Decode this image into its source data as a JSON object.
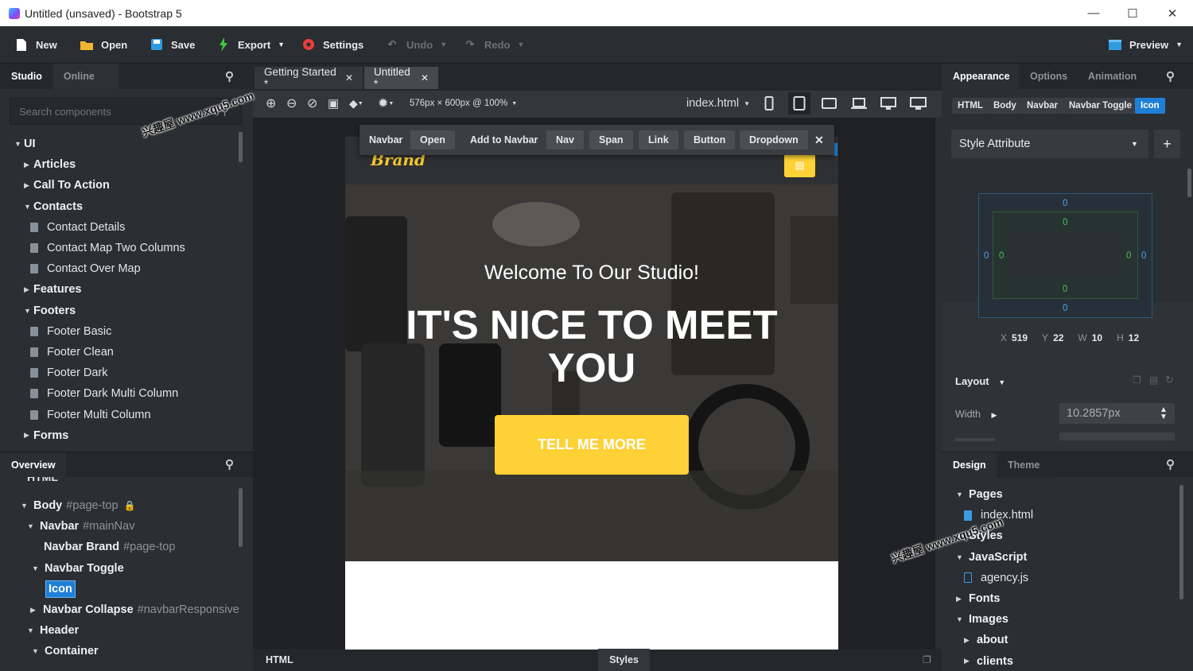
{
  "window": {
    "title": "Untitled (unsaved) - Bootstrap 5",
    "minimize": "—",
    "maximize": "☐",
    "close": "✕"
  },
  "toolbar": {
    "new": "New",
    "open": "Open",
    "save": "Save",
    "export": "Export",
    "settings": "Settings",
    "undo": "Undo",
    "redo": "Redo",
    "preview": "Preview"
  },
  "left_panel": {
    "tabs": [
      "Studio",
      "Online"
    ],
    "search_placeholder": "Search components",
    "tree": [
      {
        "label": "UI",
        "type": "group",
        "open": true
      },
      {
        "label": "Articles",
        "type": "folder",
        "open": false
      },
      {
        "label": "Call To Action",
        "type": "folder",
        "open": false
      },
      {
        "label": "Contacts",
        "type": "folder",
        "open": true
      },
      {
        "label": "Contact Details",
        "type": "item"
      },
      {
        "label": "Contact Map Two Columns",
        "type": "item"
      },
      {
        "label": "Contact Over Map",
        "type": "item"
      },
      {
        "label": "Features",
        "type": "folder",
        "open": false
      },
      {
        "label": "Footers",
        "type": "folder",
        "open": true
      },
      {
        "label": "Footer Basic",
        "type": "item"
      },
      {
        "label": "Footer Clean",
        "type": "item"
      },
      {
        "label": "Footer Dark",
        "type": "item"
      },
      {
        "label": "Footer Dark Multi Column",
        "type": "item"
      },
      {
        "label": "Footer Multi Column",
        "type": "item"
      },
      {
        "label": "Forms",
        "type": "folder",
        "open": false
      }
    ]
  },
  "overview": {
    "title": "Overview",
    "partial_top": "HTML",
    "rows": [
      {
        "label": "Body",
        "hint": "#page-top",
        "lock": "🔒"
      },
      {
        "label": "Navbar",
        "hint": "#mainNav"
      },
      {
        "label": "Navbar Brand",
        "hint": "#page-top"
      },
      {
        "label": "Navbar Toggle",
        "hint": ""
      },
      {
        "label": "Icon",
        "hint": ""
      },
      {
        "label": "Navbar Collapse",
        "hint": "#navbarResponsive"
      },
      {
        "label": "Header",
        "hint": ""
      },
      {
        "label": "Container",
        "hint": ""
      }
    ]
  },
  "editor": {
    "tabs": [
      {
        "label": "Getting Started *",
        "active": false
      },
      {
        "label": "Untitled *",
        "active": true
      }
    ],
    "viewport": "576px × 600px @ 100%",
    "file": "index.html",
    "bottom_tabs": [
      "HTML",
      "Styles"
    ]
  },
  "element_toolbar": [
    "Navbar",
    "Open",
    "Add to Navbar",
    "Nav",
    "Span",
    "Link",
    "Button",
    "Dropdown"
  ],
  "page": {
    "brand": "Brand",
    "subheading": "Welcome To Our Studio!",
    "heading_line1": "IT'S NICE TO MEET",
    "heading_line2": "YOU",
    "cta": "TELL ME MORE"
  },
  "right_panel": {
    "tabs": [
      "Appearance",
      "Options",
      "Animation"
    ],
    "breadcrumbs": [
      "HTML",
      "Body",
      "Navbar",
      "Navbar Toggle",
      "Icon"
    ],
    "style_select": "Style Attribute",
    "box_values": [
      "0",
      "0",
      "0",
      "0",
      "0",
      "0",
      "0",
      "0"
    ],
    "coords": {
      "x_label": "X",
      "x": "519",
      "y_label": "Y",
      "y": "22",
      "w_label": "W",
      "w": "10",
      "h_label": "H",
      "h": "12"
    },
    "layout_title": "Layout",
    "width_label": "Width",
    "width_value": "10.2857px",
    "accent": "#1e7fd6"
  },
  "design_panel": {
    "tabs": [
      "Design",
      "Theme"
    ],
    "tree": [
      {
        "label": "Pages",
        "type": "folder"
      },
      {
        "label": "index.html",
        "type": "file"
      },
      {
        "label": "Styles",
        "type": "folder"
      },
      {
        "label": "JavaScript",
        "type": "folder"
      },
      {
        "label": "agency.js",
        "type": "file"
      },
      {
        "label": "Fonts",
        "type": "folder"
      },
      {
        "label": "Images",
        "type": "folder"
      },
      {
        "label": "about",
        "type": "subfolder"
      },
      {
        "label": "clients",
        "type": "subfolder"
      }
    ]
  },
  "watermark": "兴趣屋 www.xqu5.com"
}
